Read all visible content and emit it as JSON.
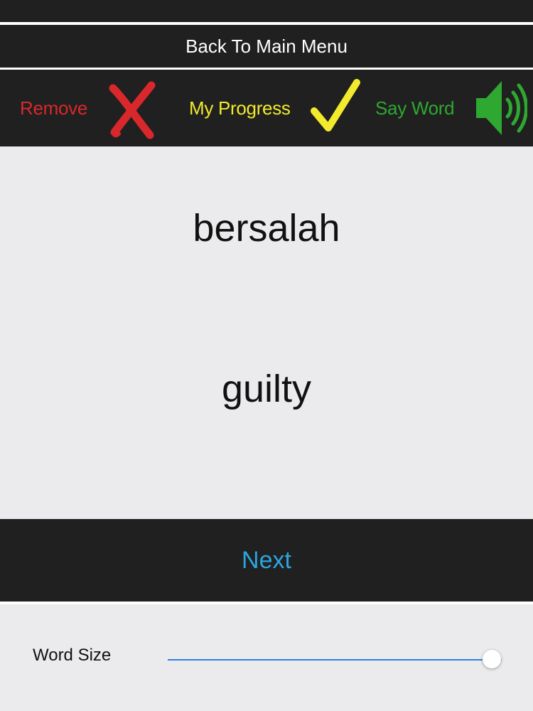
{
  "nav": {
    "back_label": "Back To Main Menu"
  },
  "toolbar": {
    "remove_label": "Remove",
    "remove_icon": "x-mark-icon",
    "progress_label": "My Progress",
    "progress_icon": "checkmark-icon",
    "say_label": "Say Word",
    "say_icon": "speaker-icon",
    "colors": {
      "remove": "#d9282b",
      "progress": "#f2ea2c",
      "say": "#2ea830"
    }
  },
  "card": {
    "word": "bersalah",
    "translation": "guilty"
  },
  "next": {
    "label": "Next",
    "color": "#2aa6df"
  },
  "settings": {
    "word_size_label": "Word Size",
    "word_size_value": 0.97,
    "accent": "#2f7fe0"
  }
}
